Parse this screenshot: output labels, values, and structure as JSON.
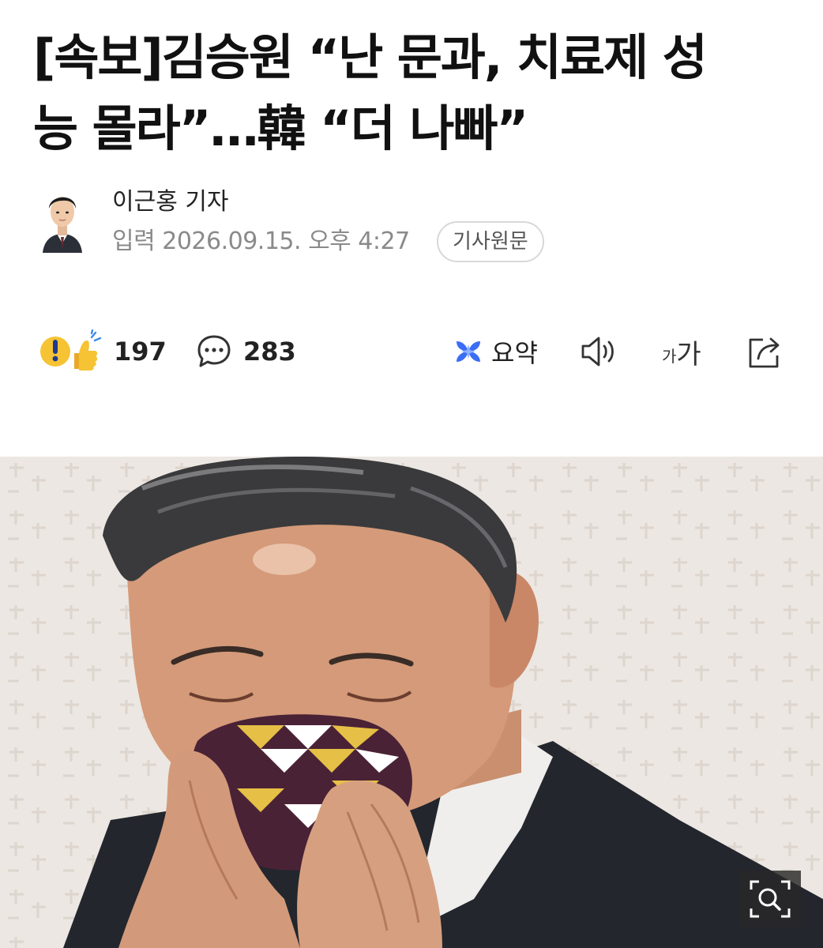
{
  "article": {
    "headline_line1": "[속보]김승원 “난 문과, 치료제 성",
    "headline_line2": "능 몰라”…韓 “더 나빠”"
  },
  "byline": {
    "reporter": "이근홍 기자",
    "published": "입력 2026.09.15. 오후 4:27",
    "source_label": "기사원문"
  },
  "actions": {
    "reaction_count": "197",
    "comment_count": "283",
    "summary_label": "요약",
    "font_size_label_small": "가",
    "font_size_label_large": "가"
  },
  "icons": {
    "reaction": "reaction-emoji-icon",
    "comment": "comment-bubble-icon",
    "summary": "ai-summary-icon",
    "audio": "speaker-icon",
    "font": "font-size-icon",
    "share": "share-icon",
    "zoom": "zoom-magnifier-icon"
  },
  "colors": {
    "text": "#111111",
    "muted": "#8a8a8a",
    "summary_accent": "#3b6df5",
    "reaction_yellow": "#f6c334"
  }
}
